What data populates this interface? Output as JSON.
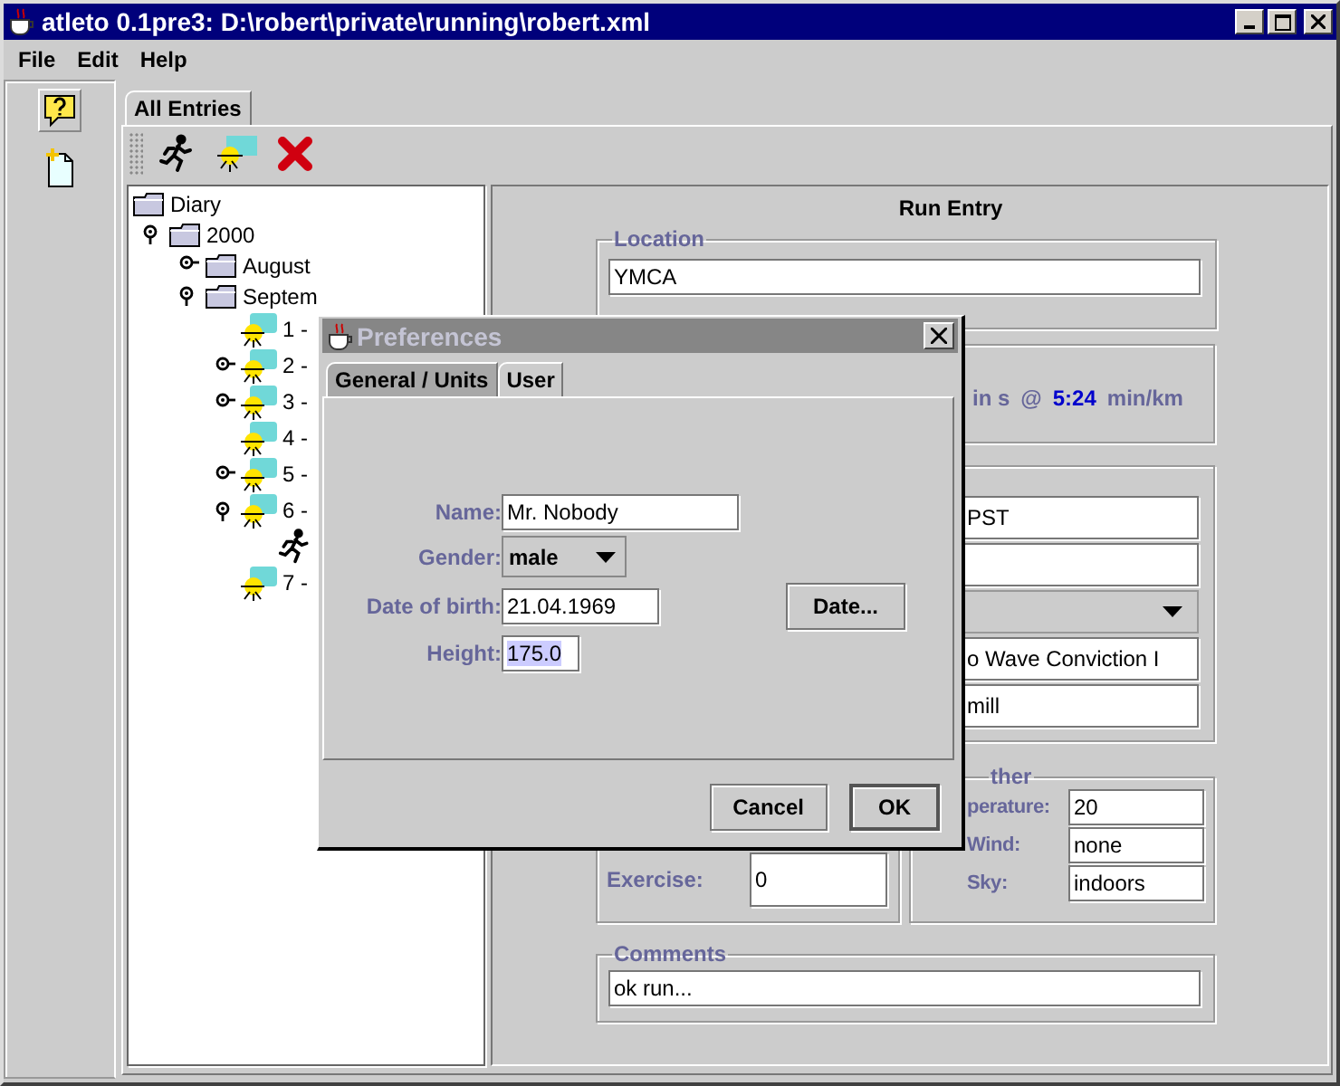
{
  "window": {
    "title": "atleto 0.1pre3: D:\\robert\\private\\running\\robert.xml"
  },
  "menu": [
    "File",
    "Edit",
    "Help"
  ],
  "tabs": [
    {
      "label": "All Entries",
      "selected": true
    }
  ],
  "tree": [
    {
      "label": "Diary",
      "kind": "folder",
      "children": [
        {
          "label": "2000",
          "kind": "folder",
          "expanded": true,
          "children": [
            {
              "label": "August",
              "kind": "folder",
              "expanded": false
            },
            {
              "label": "Septem",
              "kind": "folder",
              "expanded": true,
              "children": [
                {
                  "label": "1 -",
                  "kind": "entry"
                },
                {
                  "label": "2 -",
                  "kind": "entry",
                  "expanded": false
                },
                {
                  "label": "3 -",
                  "kind": "entry",
                  "expanded": false
                },
                {
                  "label": "4 -",
                  "kind": "entry"
                },
                {
                  "label": "5 -",
                  "kind": "entry",
                  "expanded": false
                },
                {
                  "label": "6 -",
                  "kind": "entry",
                  "expanded": true,
                  "children": [
                    {
                      "kind": "run"
                    }
                  ]
                },
                {
                  "label": "7 -",
                  "kind": "entry"
                }
              ]
            }
          ]
        }
      ]
    }
  ],
  "run_entry": {
    "title": "Run Entry",
    "location": {
      "legend": "Location",
      "value": "YMCA"
    },
    "pace": {
      "remainder": "in s",
      "at": "@",
      "value": "5:24",
      "unit": "min/km"
    },
    "details": [
      {
        "kind": "text",
        "value": "PST"
      },
      {
        "kind": "blank"
      },
      {
        "kind": "dropdown"
      },
      {
        "kind": "text",
        "value": "o Wave Conviction I"
      },
      {
        "kind": "text",
        "value": "mill"
      }
    ],
    "exercise": {
      "label": "Exercise:",
      "value": "0"
    },
    "weather": {
      "legend": "ther",
      "rows": [
        {
          "label": "perature:",
          "value": "20"
        },
        {
          "label": "Wind:",
          "value": "none"
        },
        {
          "label": "Sky:",
          "value": "indoors"
        }
      ]
    },
    "comments": {
      "legend": "Comments",
      "value": "ok run..."
    }
  },
  "dialog": {
    "title": "Preferences",
    "tabs": [
      {
        "label": "General / Units",
        "selected": false
      },
      {
        "label": "User",
        "selected": true
      }
    ],
    "fields": [
      {
        "kind": "text",
        "label": "Name:",
        "value": "Mr. Nobody",
        "selected": false
      },
      {
        "kind": "dropdown",
        "label": "Gender:",
        "value": "male",
        "selected": false
      },
      {
        "kind": "date",
        "label": "Date of birth:",
        "value": "21.04.1969",
        "button": "Date...",
        "selected": false
      },
      {
        "kind": "short",
        "label": "Height:",
        "value": "175.0",
        "selected": true
      }
    ],
    "buttons": [
      {
        "label": "Cancel",
        "default": false
      },
      {
        "label": "OK",
        "default": true
      }
    ]
  }
}
